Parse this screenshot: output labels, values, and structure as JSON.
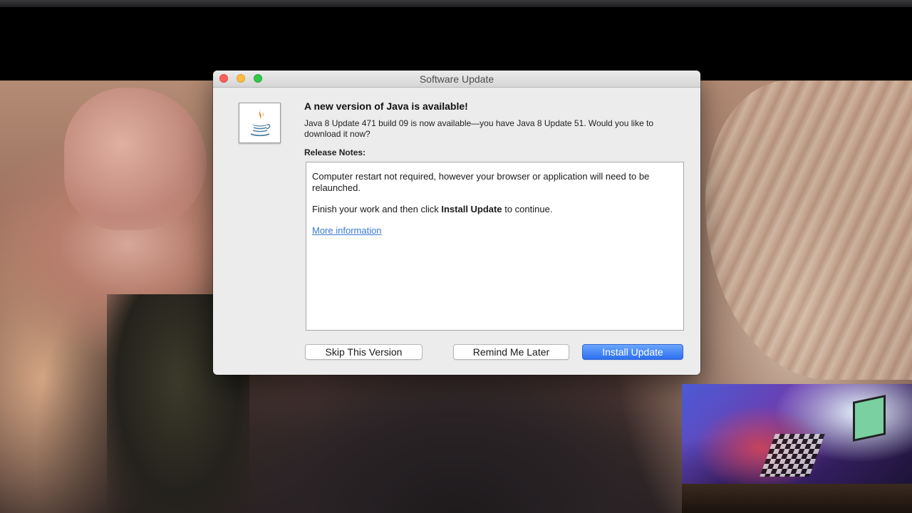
{
  "window": {
    "title": "Software Update",
    "controls": [
      "close",
      "minimize",
      "zoom"
    ]
  },
  "dialog": {
    "icon": "java-coffee-cup-icon",
    "headline": "A new version of Java is available!",
    "description": "Java 8 Update 471 build 09 is now available—you have Java 8 Update 51. Would you like to download it now?",
    "release_notes_label": "Release Notes:",
    "release_notes": {
      "line1": "Computer restart not required, however your browser or application will need to be relaunched.",
      "line2_prefix": "Finish your work and then click ",
      "line2_bold": "Install Update",
      "line2_suffix": " to continue.",
      "link": "More information"
    },
    "buttons": {
      "skip": "Skip This Version",
      "remind": "Remind Me Later",
      "install": "Install Update"
    }
  },
  "colors": {
    "close": "#fc605c",
    "minimize": "#fdbc40",
    "zoom": "#34c84a",
    "primary_button": "#2d6ff0",
    "link": "#3b7bd1",
    "java_orange": "#e76f00",
    "java_blue": "#5382a1"
  }
}
